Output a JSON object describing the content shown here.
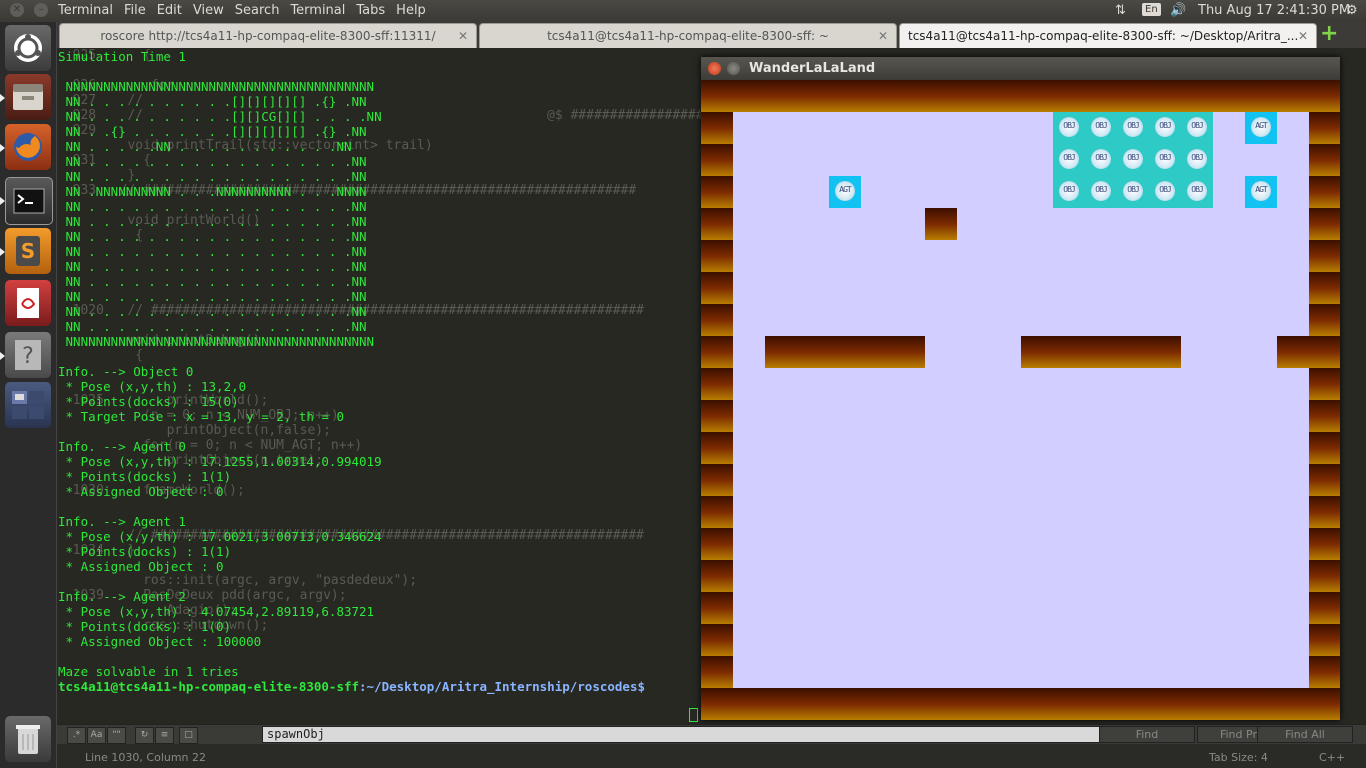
{
  "topbar": {
    "menus": [
      "Terminal",
      "File",
      "Edit",
      "View",
      "Search",
      "Terminal",
      "Tabs",
      "Help"
    ],
    "lang": "En",
    "clock": "Thu Aug 17  2:41:30 PM"
  },
  "launcher": {
    "items": [
      "ubuntu-dash",
      "files",
      "firefox",
      "terminal",
      "sublime-text",
      "libreoffice-writer",
      "unknown-app",
      "workspace-switcher",
      "trash"
    ]
  },
  "tabs": [
    {
      "label": "roscore http://tcs4a11-hp-compaq-elite-8300-sff:11311/"
    },
    {
      "label": "tcs4a11@tcs4a11-hp-compaq-elite-8300-sff: ~"
    },
    {
      "label": "tcs4a11@tcs4a11-hp-compaq-elite-8300-sff: ~/Desktop/Aritra_..."
    }
  ],
  "terminal_lines": [
    "Simulation Time 1",
    "",
    " NNNNNNNNNNNNNNNNNNNNNNNNNNNNNNNNNNNNNNNNN",
    " NN . . . . . . . . . .[][][][][] .{} .NN",
    " NN . . . . . . . . . .[][]CG[][] . . . .NN",
    " NN . .{} . . . . . . .[][][][][] .{} .NN",
    " NN . . . . .NN . . . . . . . . . . .NN",
    " NN . . . . . . . . . . . . . . . . . .NN",
    " NN . . . . . . . . . . . . . . . . . .NN",
    " NN .NNNNNNNNNN . . .NNNNNNNNNN . . .NNNN",
    " NN . . . . . . . . . . . . . . . . . .NN",
    " NN . . . . . . . . . . . . . . . . . .NN",
    " NN . . . . . . . . . . . . . . . . . .NN",
    " NN . . . . . . . . . . . . . . . . . .NN",
    " NN . . . . . . . . . . . . . . . . . .NN",
    " NN . . . . . . . . . . . . . . . . . .NN",
    " NN . . . . . . . . . . . . . . . . . .NN",
    " NN . . . . . . . . . . . . . . . . . .NN",
    " NN . . . . . . . . . . . . . . . . . .NN",
    " NNNNNNNNNNNNNNNNNNNNNNNNNNNNNNNNNNNNNNNNN",
    "",
    "Info. --> Object 0",
    " * Pose (x,y,th) : 13,2,0",
    " * Points(docks) : 15(0)",
    " * Target Pose : x = 13, y = 2, th = 0",
    "",
    "Info. --> Agent 0",
    " * Pose (x,y,th) : 17.1255,1.00314,0.994019",
    " * Points(docks) : 1(1)",
    " * Assigned Object : 0",
    "",
    "Info. --> Agent 1",
    " * Pose (x,y,th) : 17.0021,3.00713,0.346624",
    " * Points(docks) : 1(1)",
    " * Assigned Object : 0",
    "",
    "Info. --> Agent 2",
    " * Pose (x,y,th) : 4.07454,2.89119,6.83721",
    " * Points(docks) : 1(0)",
    " * Assigned Object : 100000",
    "",
    "Maze solvable in 1 tries"
  ],
  "prompt": {
    "user_host": "tcs4a11@tcs4a11-hp-compaq-elite-8300-sff",
    "path": ":~/Desktop/Aritra_Internship/roscodes$ "
  },
  "editor_lines": [
    "  925      {",
    "",
    "  926       for",
    "  927    //",
    "  928    //",
    "  929",
    "         void printTrail(std::vector<int> trail)",
    "  931      {",
    "         }",
    "  933   // ###############################################################",
    "",
    "         void printWorld()",
    "          {",
    "",
    "",
    "",
    "",
    "  1020   // ###############################################################",
    "",
    "         void printDebug()",
    "          {",
    "",
    "",
    "  1025        printWorld();",
    "           (n = 0; n < NUM_OBJ; n++)",
    "              printObject(n,false);",
    "           for(n = 0; n < NUM_AGT; n++)",
    "              printObject(n,true);",
    "",
    "  1030     frameWorld();",
    "",
    "",
    "         // ###############################################################",
    "  1034   };",
    "",
    "           ros::init(argc, argv, \"pasdedeux\");",
    "  1039     PasDeDeux pdd(argc, argv);",
    "              Adagio();",
    "           ros::shutdown();",
    "",
    "",
    "",
    ""
  ],
  "editor_right_comment": "@$ ##########################################",
  "findbar": {
    "search_value": "spawnObj",
    "find_label": "Find",
    "find_prev_label": "Find Prev",
    "find_all_label": "Find All",
    "option_icons": [
      "regex-icon",
      "case-icon",
      "whole-word-icon",
      "wrap-icon",
      "in-selection-icon",
      "highlight-icon"
    ]
  },
  "statusbar": {
    "position": "Line 1030, Column 22",
    "tab_size": "Tab Size: 4",
    "syntax": "C++"
  },
  "game_window": {
    "title": "WanderLaLaLand",
    "grid_cols": 20,
    "grid_rows": 20,
    "object_label": "OBJ",
    "agent_label": "AGT",
    "walls": [
      [
        0,
        0
      ],
      [
        1,
        0
      ],
      [
        2,
        0
      ],
      [
        3,
        0
      ],
      [
        4,
        0
      ],
      [
        5,
        0
      ],
      [
        6,
        0
      ],
      [
        7,
        0
      ],
      [
        8,
        0
      ],
      [
        9,
        0
      ],
      [
        10,
        0
      ],
      [
        11,
        0
      ],
      [
        12,
        0
      ],
      [
        13,
        0
      ],
      [
        14,
        0
      ],
      [
        15,
        0
      ],
      [
        16,
        0
      ],
      [
        17,
        0
      ],
      [
        18,
        0
      ],
      [
        19,
        0
      ],
      [
        0,
        19
      ],
      [
        1,
        19
      ],
      [
        2,
        19
      ],
      [
        3,
        19
      ],
      [
        4,
        19
      ],
      [
        5,
        19
      ],
      [
        6,
        19
      ],
      [
        7,
        19
      ],
      [
        8,
        19
      ],
      [
        9,
        19
      ],
      [
        10,
        19
      ],
      [
        11,
        19
      ],
      [
        12,
        19
      ],
      [
        13,
        19
      ],
      [
        14,
        19
      ],
      [
        15,
        19
      ],
      [
        16,
        19
      ],
      [
        17,
        19
      ],
      [
        18,
        19
      ],
      [
        19,
        19
      ],
      [
        0,
        1
      ],
      [
        0,
        2
      ],
      [
        0,
        3
      ],
      [
        0,
        4
      ],
      [
        0,
        5
      ],
      [
        0,
        6
      ],
      [
        0,
        7
      ],
      [
        0,
        8
      ],
      [
        0,
        9
      ],
      [
        0,
        10
      ],
      [
        0,
        11
      ],
      [
        0,
        12
      ],
      [
        0,
        13
      ],
      [
        0,
        14
      ],
      [
        0,
        15
      ],
      [
        0,
        16
      ],
      [
        0,
        17
      ],
      [
        0,
        18
      ],
      [
        19,
        1
      ],
      [
        19,
        2
      ],
      [
        19,
        3
      ],
      [
        19,
        4
      ],
      [
        19,
        5
      ],
      [
        19,
        6
      ],
      [
        19,
        7
      ],
      [
        19,
        8
      ],
      [
        19,
        9
      ],
      [
        19,
        10
      ],
      [
        19,
        11
      ],
      [
        19,
        12
      ],
      [
        19,
        13
      ],
      [
        19,
        14
      ],
      [
        19,
        15
      ],
      [
        19,
        16
      ],
      [
        19,
        17
      ],
      [
        19,
        18
      ],
      [
        7,
        4
      ],
      [
        2,
        8
      ],
      [
        3,
        8
      ],
      [
        4,
        8
      ],
      [
        5,
        8
      ],
      [
        6,
        8
      ],
      [
        10,
        8
      ],
      [
        11,
        8
      ],
      [
        12,
        8
      ],
      [
        13,
        8
      ],
      [
        14,
        8
      ],
      [
        18,
        8
      ]
    ],
    "objects": [
      [
        11,
        1
      ],
      [
        12,
        1
      ],
      [
        13,
        1
      ],
      [
        14,
        1
      ],
      [
        15,
        1
      ],
      [
        11,
        2
      ],
      [
        12,
        2
      ],
      [
        13,
        2
      ],
      [
        14,
        2
      ],
      [
        15,
        2
      ],
      [
        11,
        3
      ],
      [
        12,
        3
      ],
      [
        13,
        3
      ],
      [
        14,
        3
      ],
      [
        15,
        3
      ]
    ],
    "agents": [
      [
        17,
        1
      ],
      [
        17,
        3
      ],
      [
        4,
        3
      ]
    ]
  },
  "colors": {
    "terminal_text": "#2ee83a",
    "editor_bg": "#272822",
    "floor": "#d2ceff",
    "object_tile": "#2ecac6",
    "agent_tile": "#12c2f0"
  }
}
